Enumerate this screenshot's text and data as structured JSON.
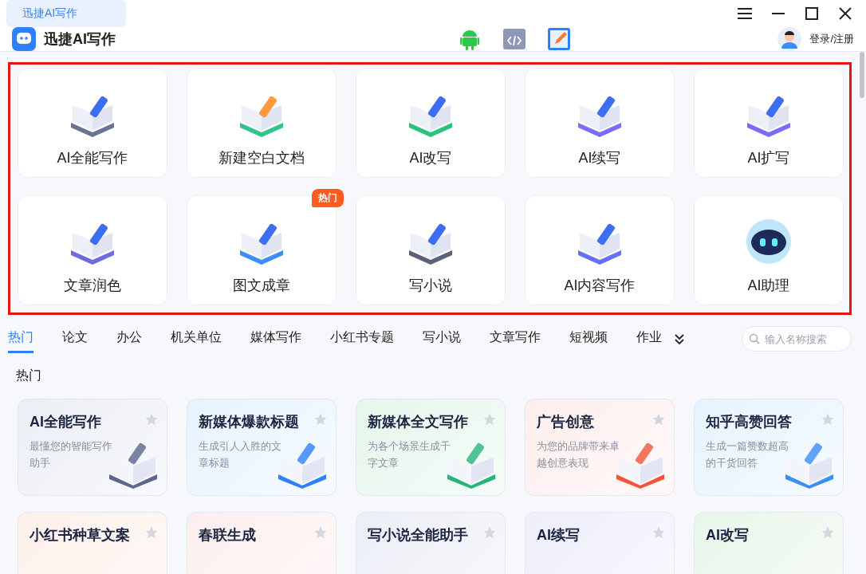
{
  "window": {
    "tab": "迅捷AI写作"
  },
  "header": {
    "app_name": "迅捷AI写作",
    "login": "登录/注册"
  },
  "tools": [
    {
      "label": "AI全能写作"
    },
    {
      "label": "新建空白文档"
    },
    {
      "label": "AI改写"
    },
    {
      "label": "AI续写"
    },
    {
      "label": "AI扩写"
    },
    {
      "label": "文章润色"
    },
    {
      "label": "图文成章",
      "badge": "热门"
    },
    {
      "label": "写小说"
    },
    {
      "label": "AI内容写作"
    },
    {
      "label": "AI助理"
    }
  ],
  "categories": [
    {
      "label": "热门",
      "selected": true
    },
    {
      "label": "论文",
      "selected": false
    },
    {
      "label": "办公",
      "selected": false
    },
    {
      "label": "机关单位",
      "selected": false
    },
    {
      "label": "媒体写作",
      "selected": false
    },
    {
      "label": "小红书专题",
      "selected": false
    },
    {
      "label": "写小说",
      "selected": false
    },
    {
      "label": "文章写作",
      "selected": false
    },
    {
      "label": "短视频",
      "selected": false
    },
    {
      "label": "作业",
      "selected": false
    }
  ],
  "search": {
    "placeholder": "输入名称搜索"
  },
  "section_title": "热门",
  "templates": [
    {
      "title": "AI全能写作",
      "desc": "最懂您的智能写作助手",
      "color": "#eceef6"
    },
    {
      "title": "新媒体爆款标题",
      "desc": "生成引人入胜的文章标题",
      "color": "#e6f3fe"
    },
    {
      "title": "新媒体全文写作",
      "desc": "为各个场景生成千字文章",
      "color": "#e5f6ec"
    },
    {
      "title": "广告创意",
      "desc": "为您的品牌带来卓越创意表现",
      "color": "#fdeeed"
    },
    {
      "title": "知乎高赞回答",
      "desc": "生成一篇赞数超高的干货回答",
      "color": "#e6f3fe"
    },
    {
      "title": "小红书种草文案",
      "color": "#fdf0ea"
    },
    {
      "title": "春联生成",
      "color": "#fdeeee"
    },
    {
      "title": "写小说全能助手",
      "color": "#eceef6"
    },
    {
      "title": "AI续写",
      "color": "#eeeefc"
    },
    {
      "title": "AI改写",
      "color": "#e8f6ea"
    }
  ]
}
